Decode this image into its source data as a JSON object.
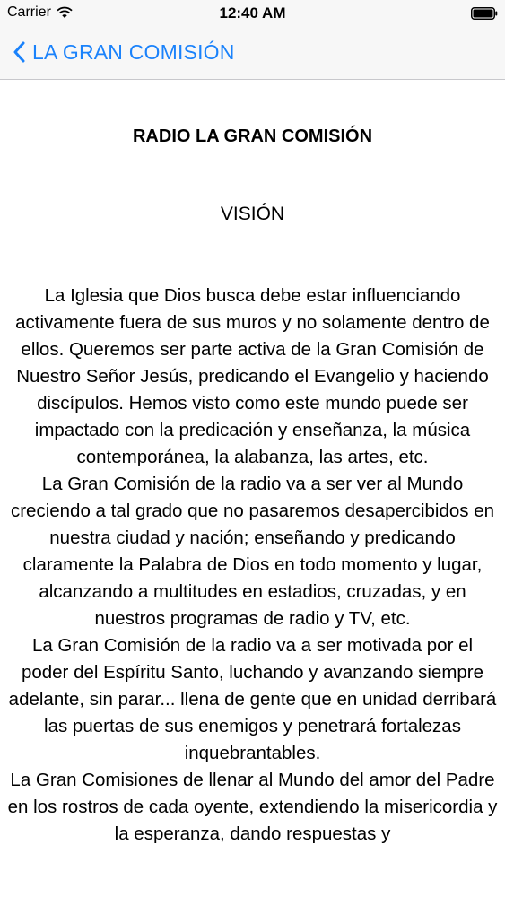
{
  "status_bar": {
    "carrier": "Carrier",
    "time": "12:40 AM",
    "wifi_icon": "wifi-icon",
    "battery_icon": "battery-icon"
  },
  "nav_bar": {
    "back_label": "LA GRAN COMISIÓN",
    "back_icon": "chevron-left-icon",
    "accent_color": "#1a82fb"
  },
  "content": {
    "title": "RADIO LA GRAN COMISIÓN",
    "subtitle": "VISIÓN",
    "paragraphs": [
      "La Iglesia que Dios busca debe estar influenciando activamente fuera de sus muros y no solamente dentro de ellos. Queremos ser parte activa de la Gran Comisión de Nuestro Señor Jesús, predicando el Evangelio y haciendo discípulos. Hemos visto como este mundo puede ser impactado con la predicación y enseñanza, la música contemporánea, la alabanza, las artes, etc.",
      "La Gran Comisión de la radio va a ser ver al Mundo creciendo a tal grado que no pasaremos desapercibidos en nuestra ciudad y nación; enseñando y predicando claramente la Palabra de Dios en todo momento y lugar, alcanzando a multitudes en estadios, cruzadas, y en nuestros programas de radio y TV, etc.",
      "La Gran Comisión de la radio va a ser motivada por el poder del Espíritu Santo, luchando y avanzando siempre adelante, sin parar... llena de gente que en unidad derribará las puertas de sus enemigos y penetrará fortalezas inquebrantables.",
      "La Gran Comisiones de llenar al Mundo del amor del Padre en los rostros de cada oyente, extendiendo la misericordia y la esperanza, dando respuestas y"
    ]
  }
}
